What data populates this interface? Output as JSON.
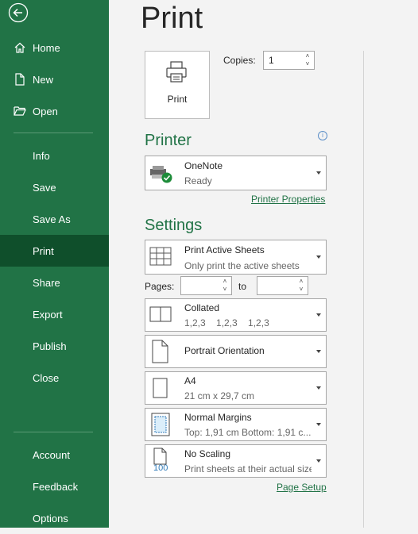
{
  "sidebar": {
    "items": [
      {
        "label": "Home",
        "icon": "home-icon"
      },
      {
        "label": "New",
        "icon": "new-file-icon"
      },
      {
        "label": "Open",
        "icon": "folder-icon"
      },
      {
        "label": "Info"
      },
      {
        "label": "Save"
      },
      {
        "label": "Save As"
      },
      {
        "label": "Print"
      },
      {
        "label": "Share"
      },
      {
        "label": "Export"
      },
      {
        "label": "Publish"
      },
      {
        "label": "Close"
      },
      {
        "label": "Account"
      },
      {
        "label": "Feedback"
      },
      {
        "label": "Options"
      }
    ]
  },
  "main": {
    "title": "Print",
    "print_button": "Print",
    "copies_label": "Copies:",
    "copies_value": "1"
  },
  "printer": {
    "heading": "Printer",
    "name": "OneNote",
    "status": "Ready",
    "properties_link": "Printer Properties"
  },
  "settings": {
    "heading": "Settings",
    "sheets": {
      "title": "Print Active Sheets",
      "subtitle": "Only print the active sheets"
    },
    "pages_label": "Pages:",
    "to_label": "to",
    "collation": {
      "title": "Collated",
      "subtitle": "1,2,3    1,2,3    1,2,3"
    },
    "orientation": {
      "title": "Portrait Orientation"
    },
    "paper": {
      "title": "A4",
      "subtitle": "21 cm x 29,7 cm"
    },
    "margins": {
      "title": "Normal Margins",
      "subtitle": "Top: 1,91 cm Bottom: 1,91 c..."
    },
    "scaling": {
      "title": "No Scaling",
      "subtitle": "Print sheets at their actual size",
      "icon_text": "100"
    },
    "page_setup_link": "Page Setup"
  },
  "colors": {
    "accent": "#217346",
    "sidebar_active": "#0f4f2b"
  }
}
